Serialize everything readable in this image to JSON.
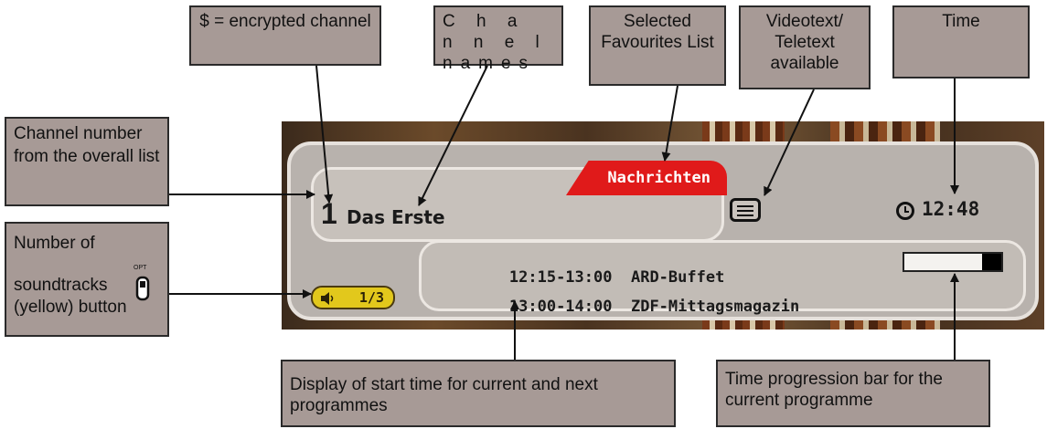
{
  "callouts": {
    "encrypted": "$ = encrypted channel",
    "channel_names": "C h a n n e l names",
    "favourites": "Selected Favourites List",
    "videotext": "Videotext/ Teletext available",
    "time": "Time",
    "channel_number": "Channel number from the overall list",
    "soundtracks_line1": "Number of",
    "soundtracks_line2": "soundtracks",
    "soundtracks_line3": "(yellow) button",
    "start_time": "Display of start time for current and next programmes",
    "progress": "Time progression bar for the current programme"
  },
  "opt_label": "OPT",
  "osd": {
    "channel_number": "1",
    "channel_name": "Das Erste",
    "favourites_list": "Nachrichten",
    "clock": "12:48",
    "programmes": [
      {
        "time": "12:15-13:00",
        "title": "ARD-Buffet"
      },
      {
        "time": "13:00-14:00",
        "title": "ZDF-Mittagsmagazin"
      }
    ],
    "soundtracks": "1/3",
    "progress_fraction": 0.8
  },
  "colors": {
    "callout_bg": "#a79a96",
    "fav_tab": "#e01a1a",
    "soundtrack_badge": "#e2c81c"
  },
  "icons": [
    "teletext-icon",
    "clock-icon",
    "speaker-icon",
    "opt-button-icon"
  ]
}
